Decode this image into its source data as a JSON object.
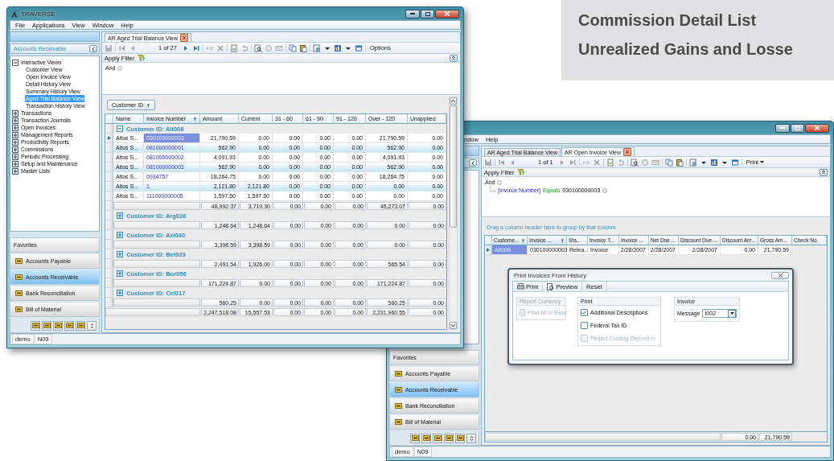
{
  "promo_panel": {
    "lines": [
      "Commission Detail List",
      "Unrealized Gains and Losse"
    ]
  },
  "main_window": {
    "title": "TRAVERSE",
    "menu": [
      "File",
      "Applications",
      "View",
      "Window",
      "Help"
    ],
    "sidebar": {
      "module_title": "Accounts Receivable",
      "tree": [
        {
          "label": "Interactive Views",
          "expanded": true,
          "children": [
            {
              "label": "Customer View",
              "selected": false
            },
            {
              "label": "Open Invoice View",
              "selected": false
            },
            {
              "label": "Detail History View",
              "selected": false
            },
            {
              "label": "Summary History View",
              "selected": false
            },
            {
              "label": "Aged Trial Balance View",
              "selected": true
            },
            {
              "label": "Transaction History View",
              "selected": false
            }
          ]
        },
        {
          "label": "Transactions",
          "expanded": false
        },
        {
          "label": "Transaction Journals",
          "expanded": false
        },
        {
          "label": "Open Invoices",
          "expanded": false
        },
        {
          "label": "Management Reports",
          "expanded": false
        },
        {
          "label": "Productivity Reports",
          "expanded": false
        },
        {
          "label": "Commissions",
          "expanded": false
        },
        {
          "label": "Periodic Processing",
          "expanded": false
        },
        {
          "label": "Setup and Maintenance",
          "expanded": false
        },
        {
          "label": "Master Lists",
          "expanded": false
        }
      ],
      "favorites_title": "Favorites",
      "favorites": [
        {
          "label": "Accounts Payable",
          "selected": false
        },
        {
          "label": "Accounts Receivable",
          "selected": true
        },
        {
          "label": "Bank Reconciliation",
          "selected": false
        },
        {
          "label": "Bill of Material",
          "selected": false
        }
      ]
    },
    "tabs": [
      {
        "label": "AR Aged Trial Balance View",
        "selected": true
      }
    ],
    "toolbar": {
      "page": "1 of 27",
      "previous_enabled": false,
      "next_enabled": true,
      "options": "Options"
    },
    "filter": {
      "title": "Apply Filter",
      "operator": "And"
    },
    "grid": {
      "group_chip": "Customer ID",
      "columns": [
        {
          "label": "Name",
          "sorted": false
        },
        {
          "label": "Invoice Number",
          "sorted": true
        },
        {
          "label": "Amount",
          "sorted": false
        },
        {
          "label": "Current",
          "sorted": false
        },
        {
          "label": "31 - 60",
          "sorted": false
        },
        {
          "label": "61 - 90",
          "sorted": false
        },
        {
          "label": "91 - 120",
          "sorted": false
        },
        {
          "label": "Over - 120",
          "sorted": false
        },
        {
          "label": "Unapplied",
          "sorted": false
        }
      ],
      "groups": [
        {
          "title": "Customer ID: Alt008",
          "expanded": true,
          "rows": [
            {
              "selected": true,
              "cells": [
                "Altos S...",
                "030100000003",
                "21,790.59",
                "0.00",
                "0.00",
                "0.00",
                "0.00",
                "21,790.59",
                "0.00"
              ]
            },
            {
              "selected": false,
              "cells": [
                "Altos S...",
                "081000000001",
                "562.90",
                "0.00",
                "0.00",
                "0.00",
                "0.00",
                "562.90",
                "0.00"
              ]
            },
            {
              "selected": false,
              "cells": [
                "Altos S...",
                "081000000002",
                "4,091.93",
                "0.00",
                "0.00",
                "0.00",
                "0.00",
                "4,091.93",
                "0.00"
              ]
            },
            {
              "selected": false,
              "cells": [
                "Altos S...",
                "081000000003",
                "562.90",
                "0.00",
                "0.00",
                "0.00",
                "0.00",
                "562.90",
                "0.00"
              ]
            },
            {
              "selected": false,
              "cells": [
                "Altos S...",
                "0934757",
                "18,264.75",
                "0.00",
                "0.00",
                "0.00",
                "0.00",
                "18,264.75",
                "0.00"
              ]
            },
            {
              "selected": false,
              "cells": [
                "Altos S...",
                "1",
                "2,121.80",
                "2,121.80",
                "0.00",
                "0.00",
                "0.00",
                "0.00",
                "0.00"
              ]
            },
            {
              "selected": false,
              "cells": [
                "Altos S...",
                "111000000005",
                "1,597.50",
                "1,597.50",
                "0.00",
                "0.00",
                "0.00",
                "0.00",
                "0.00"
              ]
            }
          ],
          "totals": [
            "48,992.37",
            "3,719.30",
            "0.00",
            "0.00",
            "0.00",
            "45,273.07",
            "0.00"
          ]
        },
        {
          "title": "Customer ID: Arg026",
          "expanded": false,
          "totals": [
            "1,248.64",
            "1,248.64",
            "0.00",
            "0.00",
            "0.00",
            "0.00",
            "0.00"
          ]
        },
        {
          "title": "Customer ID: Axi040",
          "expanded": false,
          "totals": [
            "3,398.59",
            "3,398.59",
            "0.00",
            "0.00",
            "0.00",
            "0.00",
            "0.00"
          ]
        },
        {
          "title": "Customer ID: Bet023",
          "expanded": false,
          "totals": [
            "2,491.54",
            "1,926.00",
            "0.00",
            "0.00",
            "0.00",
            "565.54",
            "0.00"
          ]
        },
        {
          "title": "Customer ID: Bur056",
          "expanded": false,
          "totals": [
            "171,224.87",
            "0.00",
            "0.00",
            "0.00",
            "0.00",
            "171,224.87",
            "0.00"
          ]
        },
        {
          "title": "Customer ID: Cel017",
          "expanded": false,
          "totals": [
            "560.25",
            "0.00",
            "0.00",
            "0.00",
            "0.00",
            "560.25",
            "0.00"
          ]
        }
      ],
      "grand_total": [
        "2,247,518.08",
        "15,557.53",
        "0.00",
        "0.00",
        "0.00",
        "2,231,960.55",
        "0.00"
      ]
    },
    "status_bar": [
      "demo",
      "N09"
    ]
  },
  "second_window": {
    "menu": [
      "ndow",
      "Help"
    ],
    "tabs": [
      {
        "label": "AR Aged Trial Balance View",
        "selected": false
      },
      {
        "label": "AR Open Invoice View",
        "selected": true
      }
    ],
    "toolbar": {
      "page": "1 of 1",
      "previous_enabled": false,
      "next_enabled": false,
      "print": "Print"
    },
    "filter": {
      "title": "Apply Filter",
      "operator": "And",
      "condition": {
        "field": "[Invoice Number]",
        "op": "Equals",
        "value": "030100000003"
      }
    },
    "group_hint": "Drag a column header here to group by that column",
    "grid": {
      "columns": [
        {
          "label": "Custome...",
          "sorted": true
        },
        {
          "label": "Invoice ...",
          "sorted": true
        },
        {
          "label": "Sta...",
          "sorted": false
        },
        {
          "label": "Invoice T...",
          "sorted": false
        },
        {
          "label": "Invoice ...",
          "sorted": false
        },
        {
          "label": "Net Due ...",
          "sorted": false
        },
        {
          "label": "Discount Due ...",
          "sorted": false
        },
        {
          "label": "Discount Am...",
          "sorted": false
        },
        {
          "label": "Gross Am...",
          "sorted": false
        },
        {
          "label": "Check No.",
          "sorted": false
        }
      ],
      "rows": [
        {
          "selected": true,
          "cells": [
            "Alt008",
            "030100000003",
            "Relea...",
            "Invoice",
            "2/28/2007",
            "2/28/2007",
            "2/28/2007",
            "0.00",
            "21,790.59"
          ]
        }
      ],
      "totals": [
        "0.00",
        "21,790.59"
      ]
    },
    "dialog": {
      "title": "Print Invoices From History",
      "actions": [
        "Print",
        "Preview",
        "Reset"
      ],
      "groups": [
        {
          "title": "Report Currency",
          "disabled": true,
          "items": [
            {
              "kind": "checkbox",
              "label": "Print All in Base",
              "checked": true,
              "disabled": true
            }
          ]
        },
        {
          "title": "Print",
          "disabled": false,
          "items": [
            {
              "kind": "checkbox",
              "label": "Additional Descriptions",
              "checked": true,
              "disabled": false
            },
            {
              "kind": "checkbox",
              "label": "Federal Tax ID",
              "checked": false,
              "disabled": false
            },
            {
              "kind": "checkbox",
              "label": "Project Costing Deposit In",
              "checked": false,
              "disabled": true
            }
          ]
        },
        {
          "title": "Invoice",
          "disabled": false,
          "items": [
            {
              "kind": "select",
              "label": "Message",
              "value": "I002"
            }
          ]
        }
      ]
    },
    "sidebar": {
      "favorites_title": "Favorites",
      "favorites": [
        {
          "label": "Accounts Payable",
          "selected": false
        },
        {
          "label": "Accounts Receivable",
          "selected": true
        },
        {
          "label": "Bank Reconciliation",
          "selected": false
        },
        {
          "label": "Bill of Material",
          "selected": false
        }
      ]
    },
    "status_bar": [
      "demo",
      "N09"
    ]
  }
}
